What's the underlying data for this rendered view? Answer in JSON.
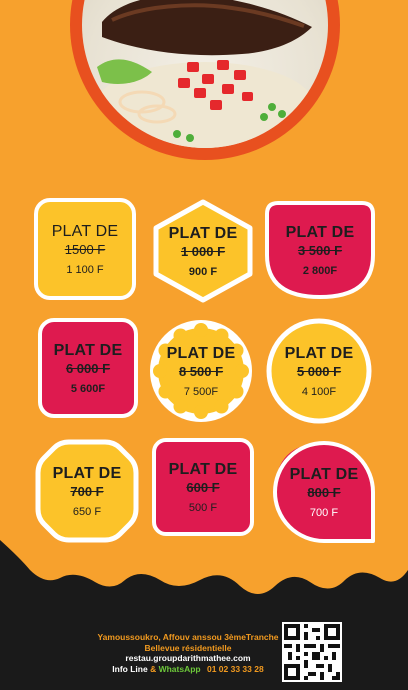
{
  "offers": [
    {
      "title": "PLAT DE",
      "old_price": "1500 F",
      "new_price": "1 100 F"
    },
    {
      "title": "PLAT DE",
      "old_price": "1 000 F",
      "new_price": "900 F"
    },
    {
      "title": "PLAT DE",
      "old_price": "3 500 F",
      "new_price": "2 800F"
    },
    {
      "title": "PLAT DE",
      "old_price": "6 000 F",
      "new_price": "5 600F"
    },
    {
      "title": "PLAT DE",
      "old_price": "8 500 F",
      "new_price": "7 500F"
    },
    {
      "title": "PLAT DE",
      "old_price": "5 000 F",
      "new_price": "4 100F"
    },
    {
      "title": "PLAT DE",
      "old_price": "700 F",
      "new_price": "650 F"
    },
    {
      "title": "PLAT DE",
      "old_price": "600 F",
      "new_price": "500 F"
    },
    {
      "title": "PLAT DE",
      "old_price": "800 F",
      "new_price": "700 F"
    }
  ],
  "footer": {
    "address_line1": "Yamoussoukro, Affouv anssou 3èmeTranche",
    "address_line2": "Bellevue   résidentielle",
    "website": "restau.groupdarithmathee.com",
    "info_label": "Info Line",
    "amp": "&",
    "whatsapp_label": "WhatsApp",
    "phone": "01 02 33 33 28"
  },
  "colors": {
    "background": "#f7a12d",
    "yellow_badge": "#fcc329",
    "red_badge": "#de1a4f",
    "footer_dark": "#1a1a1a",
    "accent_orange": "#e8501f"
  }
}
